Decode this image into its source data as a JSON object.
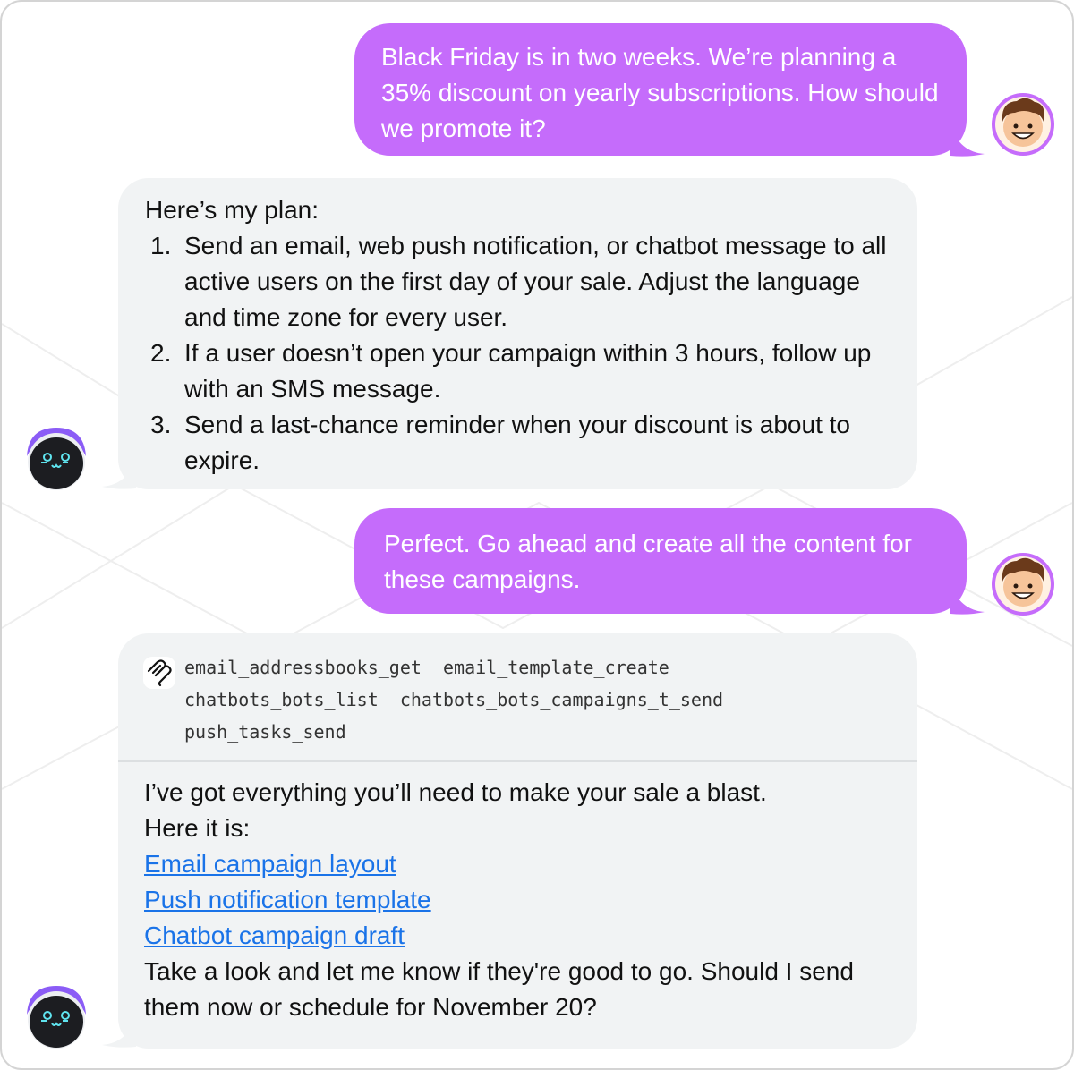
{
  "conversation": {
    "messages": [
      {
        "role": "user",
        "text": "Black Friday is in two weeks. We’re planning a 35% discount on yearly subscriptions. How should we promote it?"
      },
      {
        "role": "assistant",
        "intro": "Here’s my plan:",
        "steps": [
          {
            "num": "1.",
            "text": "Send an email, web push notification, or chatbot message to all active users on the first day of your sale. Adjust the language and time zone for every user."
          },
          {
            "num": "2.",
            "text": "If a user doesn’t open your campaign within 3 hours, follow up with an SMS message."
          },
          {
            "num": "3.",
            "text": "Send a last-chance reminder when your discount is about to expire."
          }
        ]
      },
      {
        "role": "user",
        "text": "Perfect. Go ahead and create all the content for these campaigns."
      },
      {
        "role": "assistant",
        "tools": {
          "icon": "mcp-tools-icon",
          "rows": [
            "email_addressbooks_get  email_template_create",
            "chatbots_bots_list  chatbots_bots_campaigns_t_send",
            "push_tasks_send"
          ]
        },
        "line1": "I’ve got everything you’ll need to make your sale a blast.",
        "line2": "Here it is:",
        "links": [
          "Email campaign layout",
          "Push notification template",
          "Chatbot campaign draft"
        ],
        "closing": "Take a look and let me know if they're good to go. Should I send them now or schedule for November 20?"
      }
    ]
  },
  "colors": {
    "user_bubble": "#c56cfb",
    "bot_bubble": "#f1f3f4",
    "link": "#1a73e8",
    "bot_avatar_accent": "#8b5cf6"
  }
}
